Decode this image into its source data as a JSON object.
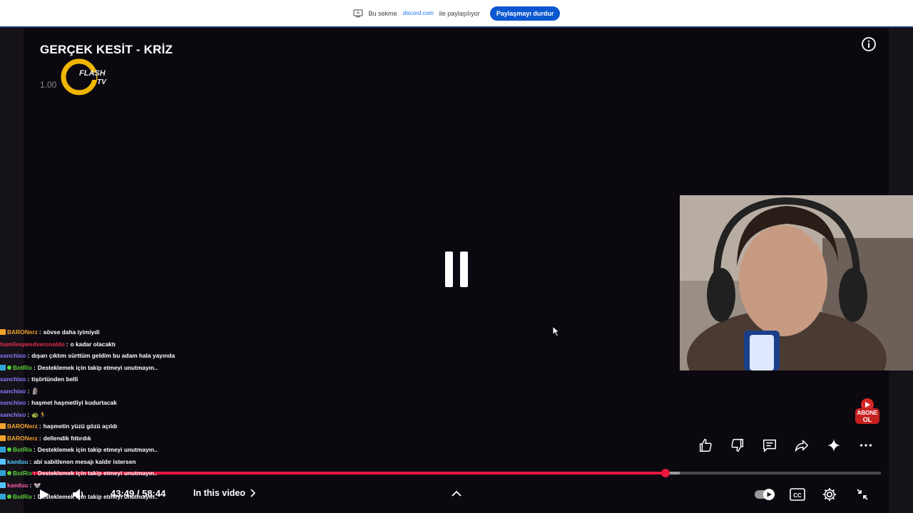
{
  "share_bar": {
    "prefix": "Bu sekme",
    "domain": "discord.com",
    "suffix": "ile paylaşılıyor",
    "stop_label": "Paylaşmayı durdur"
  },
  "video": {
    "title": "GERÇEK KESİT - KRİZ",
    "logo_text": "FLASH TV",
    "logo_number": "1.00"
  },
  "chat": [
    {
      "badge": "crown",
      "user": "BARONerz",
      "color": "#f0a32c",
      "text": "sövse daha iyimiydi"
    },
    {
      "badge": "",
      "user": "hamilespeedveronaldo",
      "color": "#e0304f",
      "text": "o kadar olacaktı"
    },
    {
      "badge": "",
      "user": "sanchixo",
      "color": "#8a7cff",
      "text": "dışarı çıktım sürttüm geldim bu adam hala yayında"
    },
    {
      "badge": "bot",
      "user": "BotRix",
      "color": "#59d13b",
      "text": "Desteklemek için takip etmeyi unutmayın.."
    },
    {
      "badge": "",
      "user": "sanchixo",
      "color": "#8a7cff",
      "text": "tişörtünden belli"
    },
    {
      "badge": "",
      "user": "sanchixo",
      "color": "#8a7cff",
      "text": "🗿"
    },
    {
      "badge": "",
      "user": "sanchixo",
      "color": "#8a7cff",
      "text": "haşmet haşmetliyi kudurtacak"
    },
    {
      "badge": "",
      "user": "sanchixo",
      "color": "#8a7cff",
      "text": "🐢🏃"
    },
    {
      "badge": "crown",
      "user": "BARONerz",
      "color": "#f0a32c",
      "text": "haşmetin yüzü gözü açıldı"
    },
    {
      "badge": "crown",
      "user": "BARONerz",
      "color": "#f0a32c",
      "text": "dellendik fıttırdık"
    },
    {
      "badge": "bot",
      "user": "BotRix",
      "color": "#59d13b",
      "text": "Desteklemek için takip etmeyi unutmayın.."
    },
    {
      "badge": "mod",
      "user": "kaeduu",
      "color": "#55c3ff",
      "text": "abi sabitlenen mesajı kaldır istersen"
    },
    {
      "badge": "bot",
      "user": "BotRix",
      "color": "#59d13b",
      "text": "Desteklemek için takip etmeyi unutmayın.."
    },
    {
      "badge": "mod",
      "user": "kaeduu",
      "color": "#ff5fae",
      "text": "🐭"
    },
    {
      "badge": "bot",
      "user": "BotRix",
      "color": "#59d13b",
      "text": "Desteklemek için takip etmeyi unutmayın.."
    }
  ],
  "player": {
    "current_time": "43:49",
    "duration": "58:44",
    "time_display": "43:49 / 58:44",
    "progress_fraction": 0.746,
    "buffer_fraction": 0.763,
    "in_this_video_label": "In this video",
    "subscribe_badge": "ABONE OL"
  },
  "colors": {
    "accent": "#e8173b",
    "share_button": "#0b57d0"
  },
  "icons": [
    "info-icon",
    "pause-icon",
    "like-icon",
    "dislike-icon",
    "comment-icon",
    "share-icon",
    "sparkle-icon",
    "more-icon",
    "play-icon",
    "volume-icon",
    "chevron-up-icon",
    "autoplay-toggle-icon",
    "cc-icon",
    "settings-icon",
    "exit-fullscreen-icon"
  ]
}
